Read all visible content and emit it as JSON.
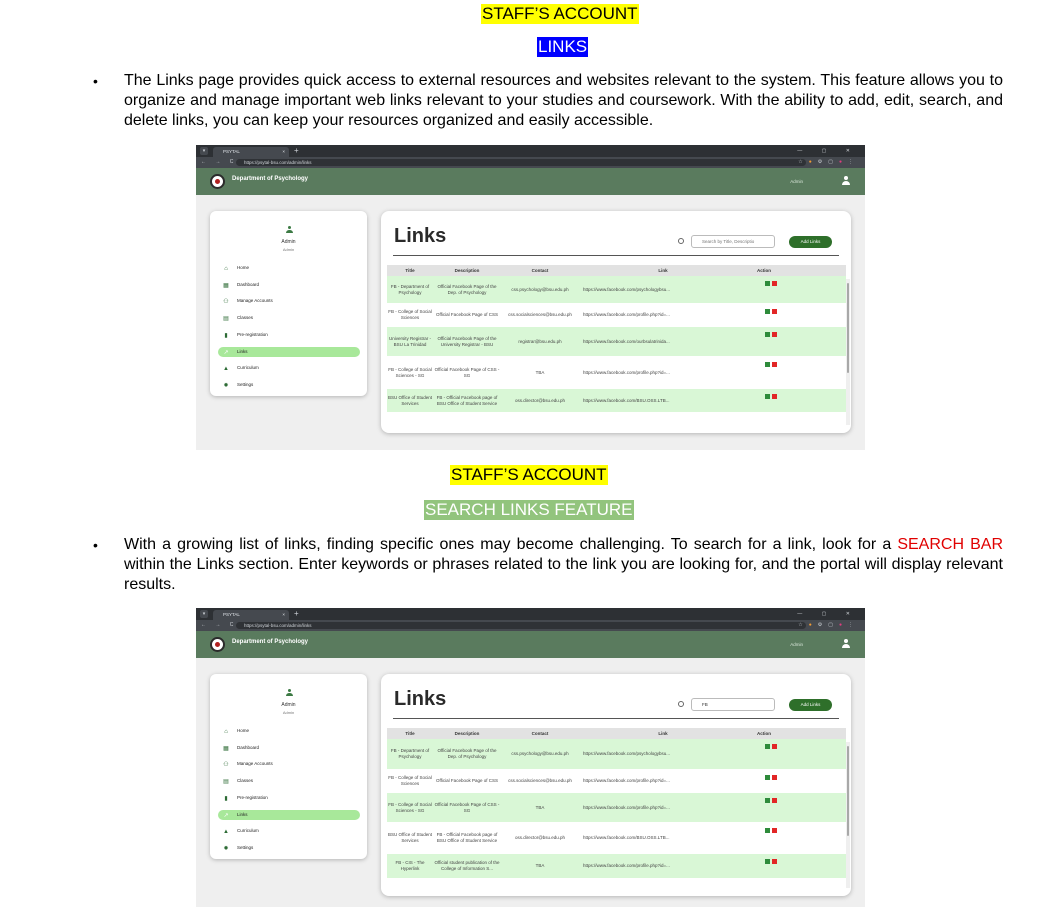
{
  "section1": {
    "heading": "STAFF’S ACCOUNT",
    "subheading": "LINKS",
    "bullet": "•",
    "paragraph": "The Links page provides quick access to external resources and websites relevant to the system. This feature allows you to organize and manage important web links relevant to your studies and coursework. With the ability to add, edit, search, and delete links, you can keep your resources organized and easily accessible."
  },
  "section2": {
    "heading": "STAFF’S ACCOUNT",
    "subheading": "SEARCH LINKS FEATURE",
    "bullet": "•",
    "paragraph_before": "With a growing list of links, finding specific ones may become challenging. To search for a link, look for a ",
    "paragraph_highlight": "SEARCH BAR",
    "paragraph_after": " within the Links section. Enter keywords or phrases related to the link you are looking for, and the portal will display relevant results."
  },
  "colors": {
    "highlight_yellow": "#ffff00",
    "highlight_blue": "#0000ff",
    "highlight_green": "#92c47d",
    "appbar_green": "#5a7b5e",
    "row_green": "#d9f7d6",
    "red_text": "#e00000"
  },
  "browser": {
    "tab_title": "PSYTAL",
    "url": "https://psytal-bsu.com/admin/links",
    "plus": "+",
    "close": "×",
    "nav": "← → C ☰",
    "window_controls": "— ▢ ✕"
  },
  "app": {
    "department": "Department of Psychology",
    "user": "Admin",
    "sidebar_name": "Admin",
    "sidebar_role": "Admin",
    "menu": [
      {
        "label": "Home",
        "icon": "home-icon",
        "glyph": "⌂"
      },
      {
        "label": "Dashboard",
        "icon": "dashboard-icon",
        "glyph": "▦"
      },
      {
        "label": "Manage Accounts",
        "icon": "accounts-icon",
        "glyph": "⚇"
      },
      {
        "label": "Classes",
        "icon": "classes-icon",
        "glyph": "▤"
      },
      {
        "label": "Pre-registration",
        "icon": "document-icon",
        "glyph": "▮"
      },
      {
        "label": "Links",
        "icon": "link-icon",
        "glyph": "↗"
      },
      {
        "label": "Curriculum",
        "icon": "graduation-cap-icon",
        "glyph": "▲"
      },
      {
        "label": "Settings",
        "icon": "gear-icon",
        "glyph": "✹"
      }
    ],
    "page_title": "Links",
    "search_placeholder": "Search by Title, Descriptio",
    "search_value": "FB",
    "add_button": "Add Links",
    "columns": [
      "Title",
      "Description",
      "Contact",
      "Link",
      "Action"
    ]
  },
  "table1": [
    {
      "title": "FB - Department of Psychology",
      "description": "Official Facebook Page of the Dep. of Psychology",
      "contact": "css.psychology@bsu.edu.ph",
      "link": "https://www.facebook.com/psychologybsu...",
      "shade": "g"
    },
    {
      "title": "FB - College of Social Sciences",
      "description": "Official Facebook Page of CSS",
      "contact": "css.socialsciences@bsu.edu.ph",
      "link": "https://www.facebook.com/profile.php?id=...",
      "shade": "w"
    },
    {
      "title": "University Registrar - BSU La Trinidad",
      "description": "Official Facebook Page of the University Registrar - BSU",
      "contact": "registrar@bsu.edu.ph",
      "link": "https://www.facebook.com/ourbsulatrinida...",
      "shade": "g"
    },
    {
      "title": "FB - College of Social Sciences - SG",
      "description": "Official Facebook Page of CSS - SG",
      "contact": "TBA",
      "link": "https://www.facebook.com/profile.php?id=...",
      "shade": "w"
    },
    {
      "title": "BSU Office of Student Services",
      "description": "FB - Official Facebook page of BSU Office of Student Service",
      "contact": "oss.director@bsu.edu.ph",
      "link": "https://www.facebook.com/BSU.OSS.LTB...",
      "shade": "g"
    }
  ],
  "table2": [
    {
      "title": "FB - Department of Psychology",
      "description": "Official Facebook Page of the Dep. of Psychology",
      "contact": "css.psychology@bsu.edu.ph",
      "link": "https://www.facebook.com/psychologybsu...",
      "shade": "g"
    },
    {
      "title": "FB - College of Social Sciences",
      "description": "Official Facebook Page of CSS",
      "contact": "css.socialsciences@bsu.edu.ph",
      "link": "https://www.facebook.com/profile.php?id=...",
      "shade": "w"
    },
    {
      "title": "FB - College of Social Sciences - SG",
      "description": "Official Facebook Page of CSS - SG",
      "contact": "TBA",
      "link": "https://www.facebook.com/profile.php?id=...",
      "shade": "g"
    },
    {
      "title": "BSU Office of Student Services",
      "description": "FB - Official Facebook page of BSU Office of Student Service",
      "contact": "oss.director@bsu.edu.ph",
      "link": "https://www.facebook.com/BSU.OSS.LTB...",
      "shade": "w"
    },
    {
      "title": "FB - CIS - The Hyperlink",
      "description": "Official student publication of the College of Information S...",
      "contact": "TBA",
      "link": "https://www.facebook.com/profile.php?id=...",
      "shade": "g"
    }
  ]
}
